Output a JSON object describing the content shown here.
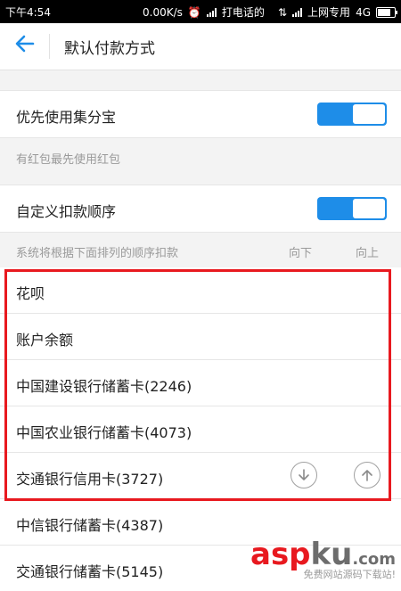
{
  "statusbar": {
    "time": "下午4:54",
    "speed": "0.00K/s",
    "carrier1": "打电话的",
    "carrier2": "上网专用",
    "network": "4G"
  },
  "navbar": {
    "title": "默认付款方式"
  },
  "settings": {
    "jifenbao_label": "优先使用集分宝",
    "jifenbao_hint": "有红包最先使用红包",
    "custom_label": "自定义扣款顺序",
    "custom_hint": "系统将根据下面排列的顺序扣款",
    "col_down": "向下",
    "col_up": "向上"
  },
  "payment_methods": [
    "花呗",
    "账户余额",
    "中国建设银行储蓄卡(2246)",
    "中国农业银行储蓄卡(4073)",
    "交通银行信用卡(3727)",
    "中信银行储蓄卡(4387)",
    "交通银行储蓄卡(5145)"
  ],
  "icons": {
    "down": "arrow-down-circle-icon",
    "up": "arrow-up-circle-icon",
    "back": "back-arrow-icon"
  },
  "colors": {
    "accent": "#1e8de8",
    "highlight": "#e8191f"
  },
  "watermark": {
    "asp": "asp",
    "ku": "ku",
    "com": ".com",
    "sub": "免费网站源码下载站!"
  }
}
